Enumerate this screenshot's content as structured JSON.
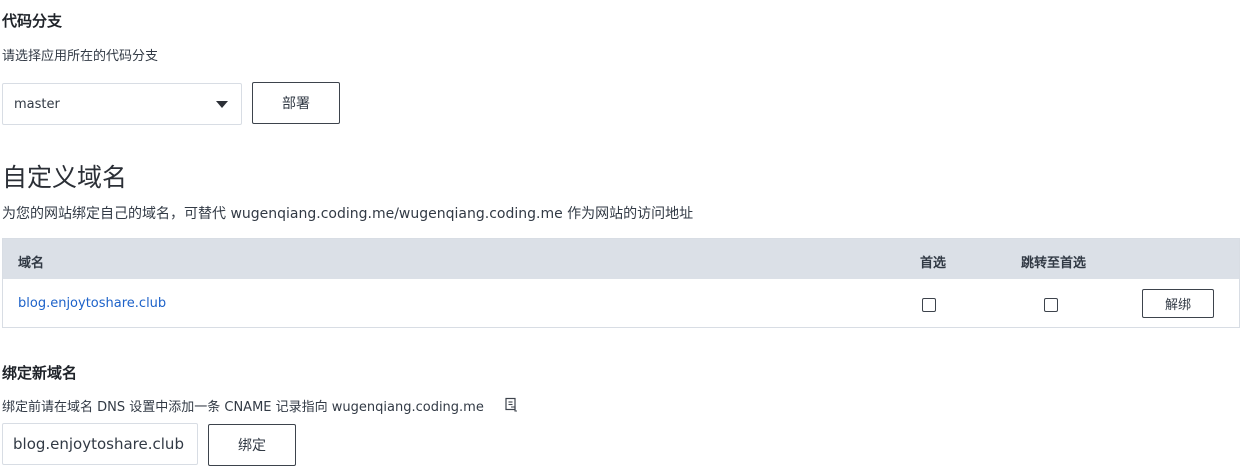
{
  "branch_section": {
    "title": "代码分支",
    "description": "请选择应用所在的代码分支",
    "select_value": "master",
    "deploy_label": "部署"
  },
  "domain_section": {
    "title": "自定义域名",
    "description": "为您的网站绑定自己的域名，可替代 wugenqiang.coding.me/wugenqiang.coding.me 作为网站的访问地址",
    "table": {
      "headers": [
        "域名",
        "首选",
        "跳转至首选"
      ],
      "rows": [
        {
          "domain": "blog.enjoytoshare.club",
          "preferred": false,
          "redirect": false,
          "action": "解绑"
        }
      ]
    }
  },
  "bind_section": {
    "title": "绑定新域名",
    "description": "绑定前请在域名 DNS 设置中添加一条 CNAME 记录指向 wugenqiang.coding.me",
    "input_value": "blog.enjoytoshare.club",
    "bind_label": "绑定"
  },
  "icons": {
    "copy": "copy-icon"
  }
}
